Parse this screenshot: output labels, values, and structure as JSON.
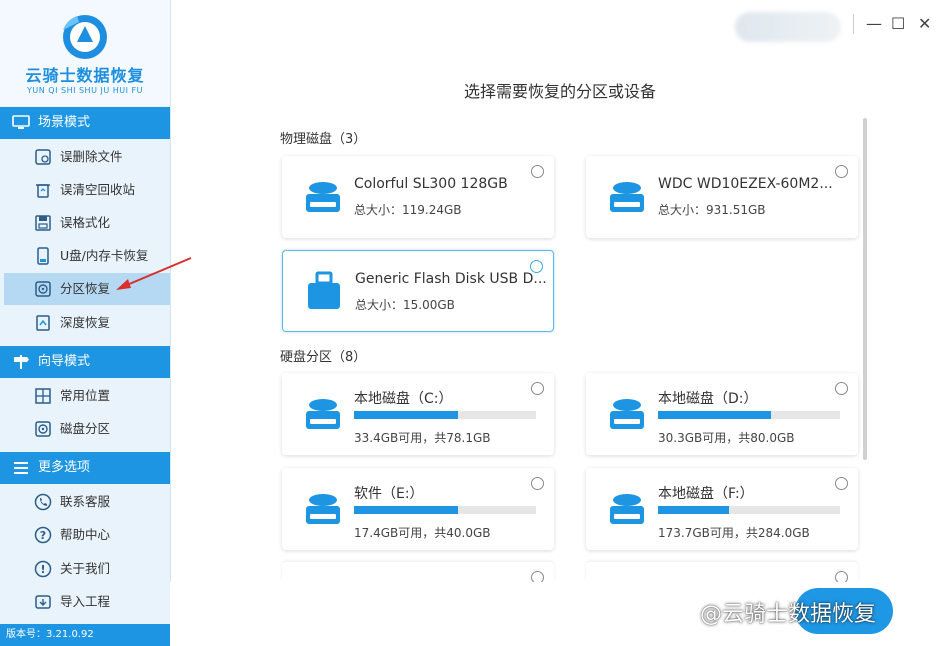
{
  "app": {
    "name": "云骑士数据恢复",
    "name_pinyin": "YUN QI SHI SHU JU HUI FU",
    "version": "版本号：3.21.0.92"
  },
  "window": {
    "minimize": "—",
    "maximize": "☐",
    "close": "✕"
  },
  "sidebar": {
    "sections": [
      {
        "title": "场景模式",
        "items": [
          {
            "label": "误删除文件",
            "icon": "deleted-file-icon"
          },
          {
            "label": "误清空回收站",
            "icon": "recycle-bin-icon"
          },
          {
            "label": "误格式化",
            "icon": "format-icon"
          },
          {
            "label": "U盘/内存卡恢复",
            "icon": "usb-card-icon"
          },
          {
            "label": "分区恢复",
            "icon": "partition-icon",
            "active": true
          },
          {
            "label": "深度恢复",
            "icon": "deep-recovery-icon"
          }
        ]
      },
      {
        "title": "向导模式",
        "items": [
          {
            "label": "常用位置",
            "icon": "windows-icon"
          },
          {
            "label": "磁盘分区",
            "icon": "disk-partition-icon"
          }
        ]
      },
      {
        "title": "更多选项",
        "items": [
          {
            "label": "联系客服",
            "icon": "phone-icon"
          },
          {
            "label": "帮助中心",
            "icon": "help-icon"
          },
          {
            "label": "关于我们",
            "icon": "info-icon"
          },
          {
            "label": "导入工程",
            "icon": "import-icon"
          }
        ]
      }
    ]
  },
  "main": {
    "title": "选择需要恢复的分区或设备",
    "physical": {
      "header": "物理磁盘（3）",
      "disks": [
        {
          "name": "Colorful SL300 128GB",
          "size": "总大小：119.24GB",
          "icon": "hard-drive-icon"
        },
        {
          "name": "WDC WD10EZEX-60M2...",
          "size": "总大小：931.51GB",
          "icon": "hard-drive-icon"
        },
        {
          "name": "Generic Flash Disk USB D...",
          "size": "总大小：15.00GB",
          "icon": "usb-drive-icon",
          "selected": true
        }
      ]
    },
    "partitions": {
      "header": "硬盘分区（8）",
      "items": [
        {
          "name": "本地磁盘（C:）",
          "usage": "33.4GB可用，共78.1GB",
          "used_fraction": 0.57
        },
        {
          "name": "本地磁盘（D:）",
          "usage": "30.3GB可用，共80.0GB",
          "used_fraction": 0.62
        },
        {
          "name": "软件（E:）",
          "usage": "17.4GB可用，共40.0GB",
          "used_fraction": 0.57
        },
        {
          "name": "本地磁盘（F:）",
          "usage": "173.7GB可用，共284.0GB",
          "used_fraction": 0.39
        }
      ]
    }
  },
  "watermark": "@云骑士数据恢复",
  "colors": {
    "accent": "#1d95e2",
    "sidebar_bg": "#e9f3fb",
    "active_item": "#b5d9f2"
  }
}
